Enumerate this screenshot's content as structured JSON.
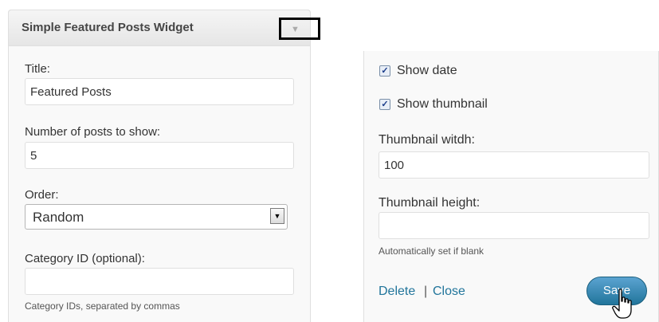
{
  "widget": {
    "title": "Simple Featured Posts Widget",
    "toggle_icon": "triangle-down"
  },
  "left": {
    "title_label": "Title:",
    "title_value": "Featured Posts",
    "num_label": "Number of posts to show:",
    "num_value": "5",
    "order_label": "Order:",
    "order_value": "Random",
    "category_label": "Category ID (optional):",
    "category_value": "",
    "category_hint": "Category IDs, separated by commas"
  },
  "right": {
    "show_date_label": "Show date",
    "show_date_checked": true,
    "show_thumb_label": "Show thumbnail",
    "show_thumb_checked": true,
    "thumb_width_label": "Thumbnail witdh:",
    "thumb_width_value": "100",
    "thumb_height_label": "Thumbnail height:",
    "thumb_height_value": "",
    "thumb_height_hint": "Automatically set if blank",
    "delete_label": "Delete",
    "separator": "|",
    "close_label": "Close",
    "save_label": "Save"
  },
  "colors": {
    "link": "#21759b",
    "save_button": "#21759b",
    "panel_bg": "#f9f9f9",
    "border": "#dfdfdf"
  }
}
